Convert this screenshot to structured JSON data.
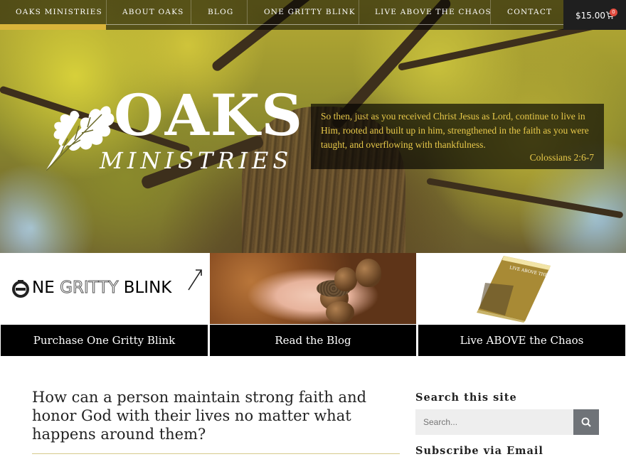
{
  "nav": {
    "items": [
      "Oaks Ministries",
      "About Oaks",
      "Blog",
      "One Gritty Blink",
      "Live Above The Chaos",
      "Contact"
    ],
    "cart_total": "$15.00",
    "cart_count": "0"
  },
  "logo": {
    "line1": "OAKS",
    "line2": "MINISTRIES"
  },
  "verse": {
    "text": "So then, just as you received Christ Jesus as Lord, continue to live in Him, rooted and built up in him, strengthened in the faith as you were taught, and overflowing with thankfulness.",
    "reference": "Colossians 2:6-7"
  },
  "promos": {
    "ogb_logo": {
      "one": "NE",
      "gritty": "GRITTY",
      "blink": "BLINK"
    },
    "tiles": [
      "Purchase One Gritty Blink",
      "Read the Blog",
      "Live ABOVE the Chaos"
    ],
    "book_title": "LIVE ABOVE THE CHAOS"
  },
  "main": {
    "headline": "How can a person maintain strong faith and honor God with their lives no matter what happens around them?"
  },
  "sidebar": {
    "search_title": "Search this site",
    "search_placeholder": "Search...",
    "subscribe_title": "Subscribe via Email"
  },
  "colors": {
    "accent": "#d9b43a",
    "verse_text": "#e8c94a"
  },
  "icons": {
    "search": "search-icon",
    "cart": "cart-icon",
    "leaf": "oak-leaf-icon"
  }
}
